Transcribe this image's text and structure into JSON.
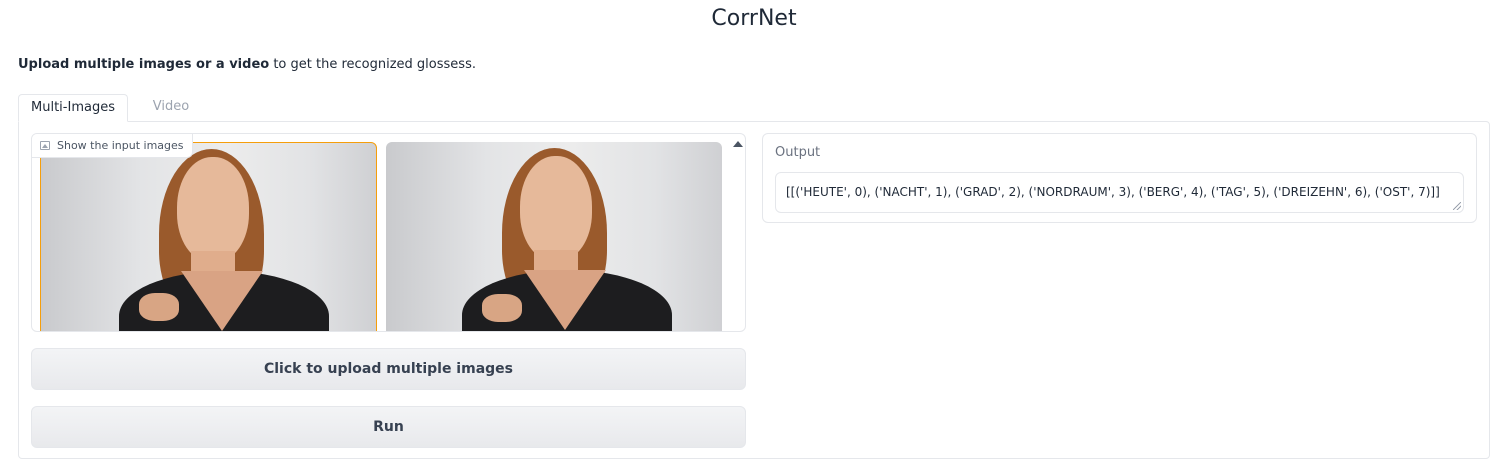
{
  "app": {
    "title": "CorrNet"
  },
  "description": {
    "bold": "Upload multiple images or a video",
    "rest": " to get the recognized glossess."
  },
  "tabs": [
    {
      "label": "Multi-Images",
      "active": true
    },
    {
      "label": "Video",
      "active": false
    }
  ],
  "gallery": {
    "label": "Show the input images",
    "icon": "image-icon",
    "images": [
      {
        "selected": true
      },
      {
        "selected": false
      }
    ]
  },
  "buttons": {
    "upload_label": "Click to upload multiple images",
    "run_label": "Run"
  },
  "output": {
    "label": "Output",
    "value": "[[('HEUTE', 0), ('NACHT', 1), ('GRAD', 2), ('NORDRAUM', 3), ('BERG', 4), ('TAG', 5), ('DREIZEHN', 6), ('OST', 7)]]"
  },
  "colors": {
    "accent": "#f59e0b",
    "border": "#e5e7eb",
    "inactive_text": "#9ca3af"
  }
}
